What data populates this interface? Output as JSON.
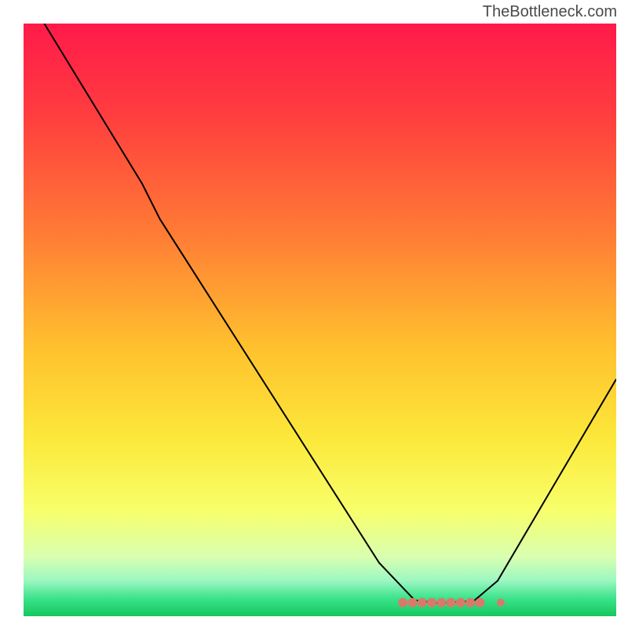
{
  "watermark": "TheBottleneck.com",
  "chart_data": {
    "type": "line",
    "title": "",
    "xlabel": "",
    "ylabel": "",
    "xlim": [
      0,
      100
    ],
    "ylim": [
      0,
      100
    ],
    "background_gradient": {
      "stops": [
        {
          "offset": 0,
          "color": "#ff1a4a"
        },
        {
          "offset": 15,
          "color": "#ff3c3f"
        },
        {
          "offset": 35,
          "color": "#ff7a35"
        },
        {
          "offset": 55,
          "color": "#ffc22e"
        },
        {
          "offset": 70,
          "color": "#fce83a"
        },
        {
          "offset": 82,
          "color": "#f8ff6a"
        },
        {
          "offset": 90,
          "color": "#d9ffb0"
        },
        {
          "offset": 94,
          "color": "#9cf7c2"
        },
        {
          "offset": 97,
          "color": "#3be38a"
        },
        {
          "offset": 100,
          "color": "#15c65f"
        }
      ]
    },
    "series": [
      {
        "name": "bottleneck-curve",
        "stroke": "#000000",
        "stroke_width": 2,
        "points": [
          {
            "x": 3.5,
            "y": 100
          },
          {
            "x": 20,
            "y": 73
          },
          {
            "x": 23,
            "y": 67
          },
          {
            "x": 60,
            "y": 9
          },
          {
            "x": 66,
            "y": 2.7
          },
          {
            "x": 70,
            "y": 2.2
          },
          {
            "x": 76,
            "y": 2.6
          },
          {
            "x": 80,
            "y": 6
          },
          {
            "x": 100,
            "y": 40
          }
        ]
      }
    ],
    "markers": {
      "color": "#d87a6a",
      "y": 2.3,
      "x_start": 64,
      "x_end": 77,
      "count": 9,
      "outlier_x": 80.5
    }
  }
}
